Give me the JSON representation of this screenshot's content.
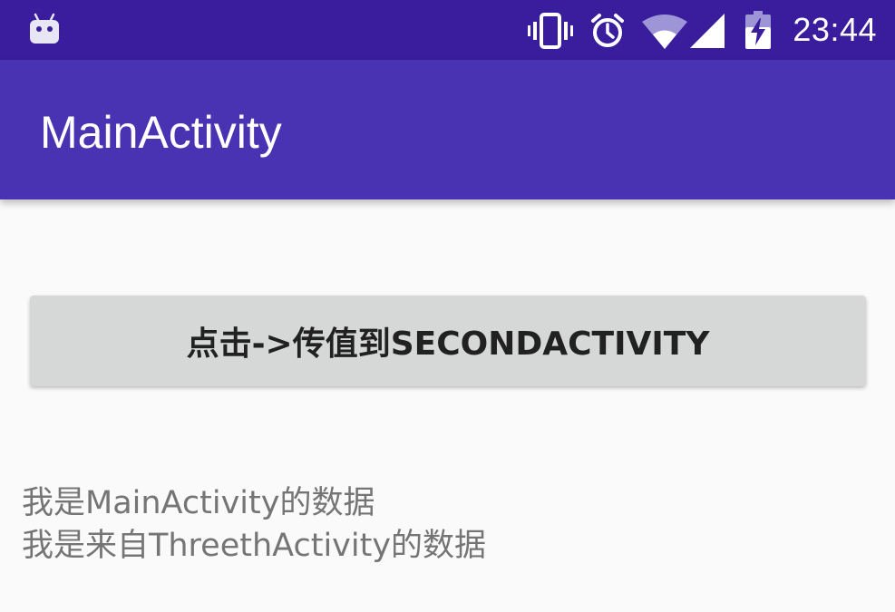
{
  "status_bar": {
    "time": "23:44",
    "bg_color": "#3A1D9C",
    "icons": [
      "android-debug-icon",
      "vibrate-icon",
      "alarm-icon",
      "wifi-icon",
      "signal-icon",
      "battery-charging-icon"
    ]
  },
  "app_bar": {
    "title": "MainActivity",
    "bg_color": "#4A33B3"
  },
  "main": {
    "button_label": "点击->传值到SECONDACTIVITY",
    "lines": [
      "我是MainActivity的数据",
      "我是来自ThreethActivity的数据"
    ]
  }
}
